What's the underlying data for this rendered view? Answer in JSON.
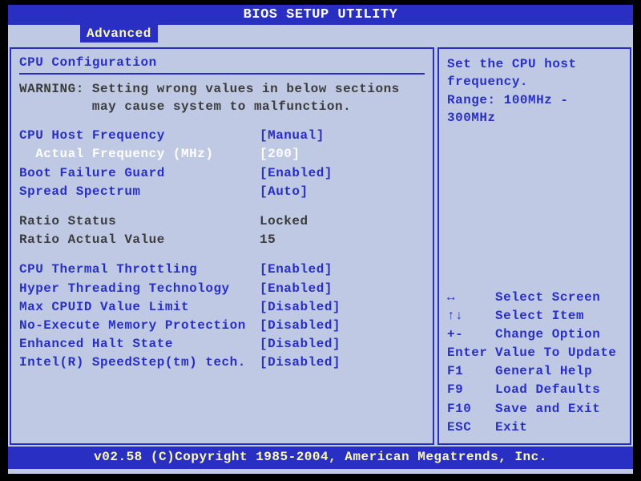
{
  "title": "BIOS SETUP UTILITY",
  "tab": "Advanced",
  "section_heading": "CPU Configuration",
  "warning_label": "WARNING:",
  "warning_text_1": "Setting wrong values in below sections",
  "warning_text_2": "may cause system to malfunction.",
  "settings": [
    {
      "label": "CPU Host Frequency",
      "value": "[Manual]",
      "kind": "option",
      "selected": false
    },
    {
      "label": "  Actual Frequency (MHz)",
      "value": "[200]",
      "kind": "option",
      "selected": true
    },
    {
      "label": "Boot Failure Guard",
      "value": "[Enabled]",
      "kind": "option",
      "selected": false
    },
    {
      "label": "Spread Spectrum",
      "value": "[Auto]",
      "kind": "option",
      "selected": false
    }
  ],
  "readonly": [
    {
      "label": "Ratio Status",
      "value": "Locked"
    },
    {
      "label": "Ratio Actual Value",
      "value": "15"
    }
  ],
  "settings2": [
    {
      "label": "CPU Thermal Throttling",
      "value": "[Enabled]",
      "kind": "option"
    },
    {
      "label": "Hyper Threading Technology",
      "value": "[Enabled]",
      "kind": "option"
    },
    {
      "label": "Max CPUID Value Limit",
      "value": "[Disabled]",
      "kind": "option"
    },
    {
      "label": "No-Execute Memory Protection",
      "value": "[Disabled]",
      "kind": "option"
    },
    {
      "label": "Enhanced Halt State",
      "value": "[Disabled]",
      "kind": "option"
    },
    {
      "label": "Intel(R) SpeedStep(tm) tech.",
      "value": "[Disabled]",
      "kind": "option"
    }
  ],
  "help": {
    "line1": "Set the CPU host",
    "line2": "frequency.",
    "line3": "Range: 100MHz - 300MHz"
  },
  "keys": [
    {
      "k": "↔",
      "d": "Select Screen"
    },
    {
      "k": "↑↓",
      "d": "Select Item"
    },
    {
      "k": "+-",
      "d": "Change Option"
    },
    {
      "k": "Enter",
      "d": "Value To Update"
    },
    {
      "k": "F1",
      "d": "General Help"
    },
    {
      "k": "F9",
      "d": "Load Defaults"
    },
    {
      "k": "F10",
      "d": "Save and Exit"
    },
    {
      "k": "ESC",
      "d": "Exit"
    }
  ],
  "footer": "v02.58 (C)Copyright 1985-2004, American Megatrends, Inc."
}
